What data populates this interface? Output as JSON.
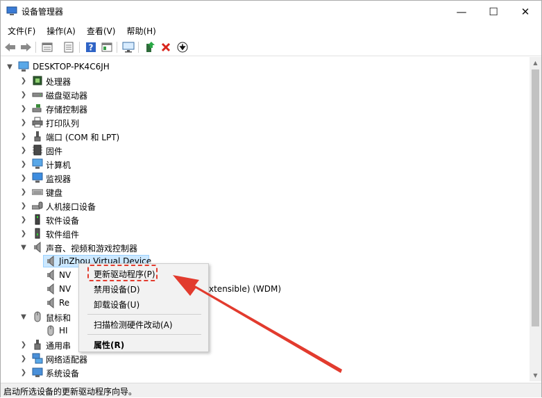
{
  "window": {
    "title": "设备管理器",
    "minimize_glyph": "—",
    "maximize_glyph": "☐",
    "close_glyph": "✕"
  },
  "menubar": {
    "items": [
      "文件(F)",
      "操作(A)",
      "查看(V)",
      "帮助(H)"
    ]
  },
  "toolbar": {
    "buttons": [
      "back-arrow-icon",
      "forward-arrow-icon",
      "properties-icon",
      "print-icon",
      "help-icon",
      "view-icon",
      "monitor-icon",
      "update-driver-icon",
      "delete-icon",
      "download-icon"
    ]
  },
  "tree": {
    "root": "DESKTOP-PK4C6JH",
    "categories": [
      {
        "label": "处理器",
        "icon": "processor-icon"
      },
      {
        "label": "磁盘驱动器",
        "icon": "disk-drive-icon"
      },
      {
        "label": "存储控制器",
        "icon": "storage-controller-icon"
      },
      {
        "label": "打印队列",
        "icon": "printer-icon"
      },
      {
        "label": "端口 (COM 和 LPT)",
        "icon": "port-icon"
      },
      {
        "label": "固件",
        "icon": "firmware-icon"
      },
      {
        "label": "计算机",
        "icon": "computer-icon"
      },
      {
        "label": "监视器",
        "icon": "monitor-icon"
      },
      {
        "label": "键盘",
        "icon": "keyboard-icon"
      },
      {
        "label": "人机接口设备",
        "icon": "hid-icon"
      },
      {
        "label": "软件设备",
        "icon": "software-device-icon"
      },
      {
        "label": "软件组件",
        "icon": "software-component-icon"
      },
      {
        "label": "声音、视频和游戏控制器",
        "icon": "speaker-icon",
        "expanded": true
      }
    ],
    "sound_children": [
      {
        "label": "JinZhou Virtual Device",
        "selected": true
      },
      {
        "label": "NV"
      },
      {
        "label": "NV",
        "suffix": "xtensible) (WDM)"
      },
      {
        "label": "Re"
      }
    ],
    "mouse_category": {
      "label": "鼠标和",
      "expanded": true
    },
    "mouse_children": [
      {
        "label": "HI"
      }
    ],
    "after": [
      {
        "label": "通用串",
        "icon": "usb-icon"
      },
      {
        "label": "网络适配器",
        "icon": "network-adapter-icon"
      },
      {
        "label": "系统设备",
        "icon": "system-device-icon"
      }
    ]
  },
  "context_menu": {
    "items": [
      {
        "label": "更新驱动程序(P)",
        "bold": false
      },
      {
        "label": "禁用设备(D)",
        "bold": false
      },
      {
        "label": "卸载设备(U)",
        "bold": false
      },
      {
        "label": "扫描检测硬件改动(A)",
        "bold": false
      },
      {
        "label": "属性(R)",
        "bold": true
      }
    ]
  },
  "statusbar": {
    "text": "启动所选设备的更新驱动程序向导。"
  },
  "colors": {
    "selection": "#cce8ff",
    "annotation_red": "#e23b2e"
  }
}
